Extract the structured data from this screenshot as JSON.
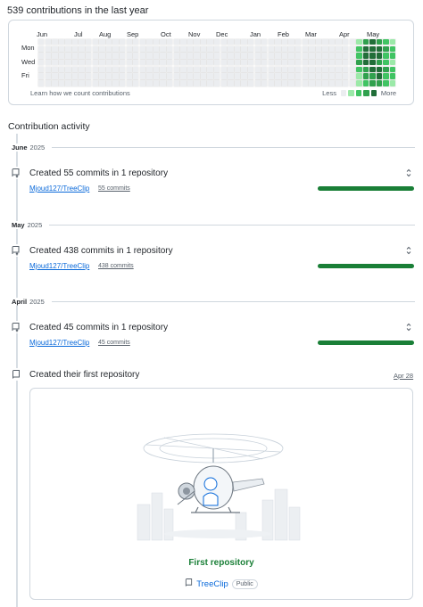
{
  "contributions": {
    "title": "539 contributions in the last year",
    "months": [
      "Jun",
      "Jul",
      "Aug",
      "Sep",
      "Oct",
      "Nov",
      "Dec",
      "Jan",
      "Feb",
      "Mar",
      "Apr",
      "May"
    ],
    "weekdays": [
      "Mon",
      "Wed",
      "Fri"
    ],
    "learn_link": "Learn how we count contributions",
    "legend_less": "Less",
    "legend_more": "More",
    "level_colors": [
      "#ebedf0",
      "#9be9a8",
      "#40c463",
      "#30a14e",
      "#216e39"
    ],
    "active_weeks": [
      [
        1,
        2,
        2,
        3,
        2,
        1,
        1
      ],
      [
        3,
        4,
        4,
        4,
        3,
        3,
        2
      ],
      [
        4,
        4,
        4,
        4,
        4,
        3,
        3
      ],
      [
        3,
        4,
        4,
        3,
        4,
        4,
        3
      ],
      [
        2,
        3,
        2,
        2,
        3,
        2,
        2
      ],
      [
        1,
        2,
        2,
        1,
        2,
        2,
        1
      ]
    ]
  },
  "activity": {
    "title": "Contribution activity",
    "groups": [
      {
        "month": "June",
        "year": "2025",
        "summary": "Created 55 commits in 1 repository",
        "repo": "Mjoud127/TreeClip",
        "count": "55 commits",
        "share": 1.0
      },
      {
        "month": "May",
        "year": "2025",
        "summary": "Created 438 commits in 1 repository",
        "repo": "Mjoud127/TreeClip",
        "count": "438 commits",
        "share": 1.0
      },
      {
        "month": "April",
        "year": "2025",
        "summary": "Created 45 commits in 1 repository",
        "repo": "Mjoud127/TreeClip",
        "count": "45 commits",
        "share": 1.0
      }
    ],
    "first_repo": {
      "summary": "Created their first repository",
      "date": "Apr 28",
      "card_title": "First repository",
      "repo_name": "TreeClip",
      "visibility": "Public"
    }
  },
  "icons": {
    "commit": "repo-push-icon",
    "repo": "repo-icon",
    "toggle": "unfold-icon"
  }
}
